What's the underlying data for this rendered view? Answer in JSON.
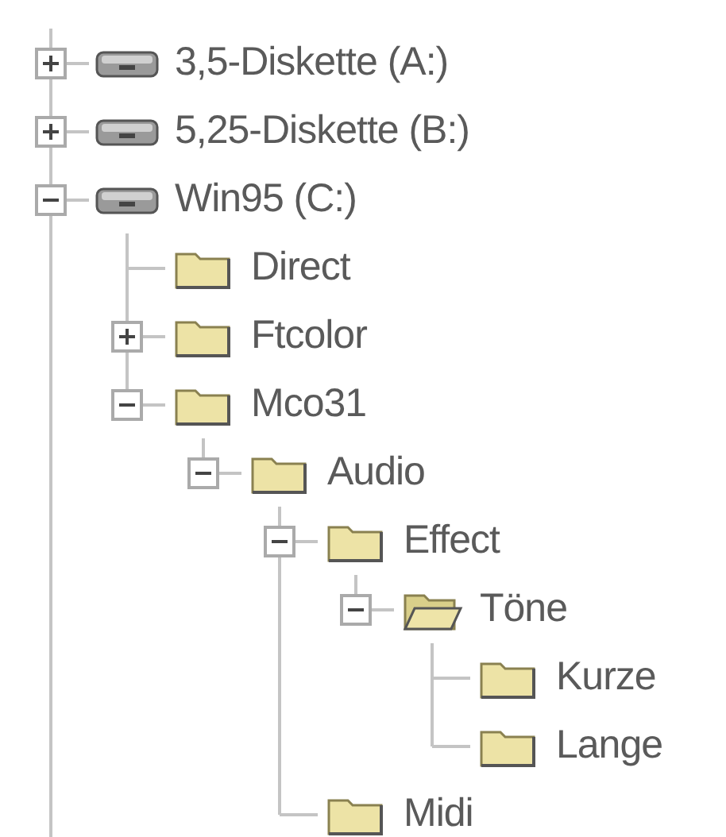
{
  "items": [
    {
      "label": "3,5-Diskette (A:)",
      "kind": "drive",
      "expanded": false
    },
    {
      "label": "5,25-Diskette (B:)",
      "kind": "drive",
      "expanded": false
    },
    {
      "label": "Win95 (C:)",
      "kind": "drive",
      "expanded": true,
      "children": [
        {
          "label": "Direct",
          "kind": "folder",
          "open": false
        },
        {
          "label": "Ftcolor",
          "kind": "folder",
          "open": false,
          "expanded": false
        },
        {
          "label": "Mco31",
          "kind": "folder",
          "open": false,
          "expanded": true,
          "children": [
            {
              "label": "Audio",
              "kind": "folder",
              "open": false,
              "expanded": true,
              "children": [
                {
                  "label": "Effect",
                  "kind": "folder",
                  "open": false,
                  "expanded": true,
                  "children": [
                    {
                      "label": "Töne",
                      "kind": "folder",
                      "open": true,
                      "expanded": true,
                      "children": [
                        {
                          "label": "Kurze",
                          "kind": "folder",
                          "open": false
                        },
                        {
                          "label": "Lange",
                          "kind": "folder",
                          "open": false
                        }
                      ]
                    }
                  ]
                },
                {
                  "label": "Midi",
                  "kind": "folder",
                  "open": false
                }
              ]
            }
          ]
        }
      ]
    }
  ]
}
